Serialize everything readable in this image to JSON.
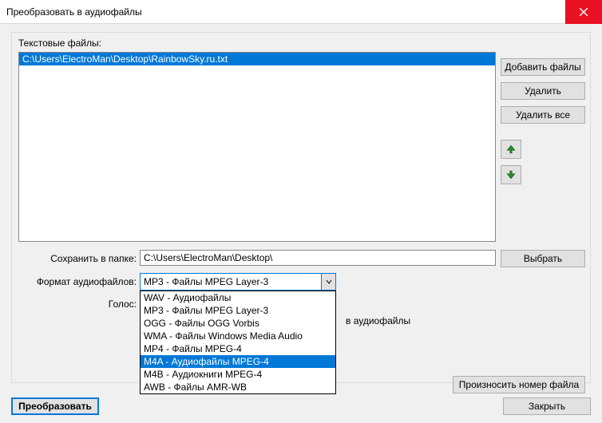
{
  "window": {
    "title": "Преобразовать в аудиофайлы"
  },
  "labels": {
    "text_files": "Текстовые файлы:",
    "save_in_folder": "Сохранить в папке:",
    "audio_format": "Формат аудиофайлов:",
    "voice": "Голос:"
  },
  "file_list": {
    "items": [
      "C:\\Users\\ElectroMan\\Desktop\\RainbowSky.ru.txt"
    ]
  },
  "buttons": {
    "add_files": "Добавить файлы",
    "delete": "Удалить",
    "delete_all": "Удалить все",
    "choose": "Выбрать",
    "say_filenum": "Произносить номер файла",
    "convert": "Преобразовать",
    "close": "Закрыть"
  },
  "folder": {
    "path": "C:\\Users\\ElectroMan\\Desktop\\"
  },
  "format": {
    "selected": "MP3 - Файлы MPEG Layer-3",
    "options": [
      "WAV - Аудиофайлы",
      "MP3 - Файлы MPEG Layer-3",
      "OGG - Файлы OGG Vorbis",
      "WMA - Файлы Windows Media Audio",
      "MP4 - Файлы MPEG-4",
      "M4A - Аудиофайлы MPEG-4",
      "M4B - Аудиокниги MPEG-4",
      "AWB - Файлы AMR-WB"
    ],
    "highlighted_index": 5
  },
  "hint": {
    "partial_text": "в аудиофайлы"
  }
}
